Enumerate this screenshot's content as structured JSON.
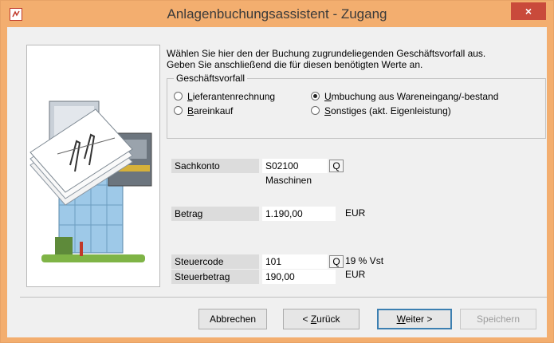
{
  "window": {
    "title": "Anlagenbuchungsassistent - Zugang",
    "close_symbol": "×"
  },
  "intro": {
    "line1": "Wählen Sie hier den der Buchung zugrundeliegenden Geschäftsvorfall aus.",
    "line2": "Geben Sie anschließend die für diesen benötigten Werte an."
  },
  "geschaeftsvorfall": {
    "legend": "Geschäftsvorfall",
    "options": [
      {
        "label": "Lieferantenrechnung",
        "mnemonic": "L",
        "rest": "ieferantenrechnung",
        "selected": false
      },
      {
        "label": "Umbuchung aus Wareneingang/-bestand",
        "mnemonic": "U",
        "rest": "mbuchung aus Wareneingang/-bestand",
        "selected": true
      },
      {
        "label": "Bareinkauf",
        "mnemonic": "B",
        "rest": "areinkauf",
        "selected": false
      },
      {
        "label": "Sonstiges (akt. Eigenleistung)",
        "mnemonic": "S",
        "rest": "onstiges (akt. Eigenleistung)",
        "selected": false
      }
    ]
  },
  "fields": {
    "sachkonto_label": "Sachkonto",
    "sachkonto_value": "S02100",
    "sachkonto_name": "Maschinen",
    "betrag_label": "Betrag",
    "betrag_value": "1.190,00",
    "betrag_currency": "EUR",
    "steuercode_label": "Steuercode",
    "steuercode_value": "101",
    "steuercode_desc": "19 % Vst",
    "steuerbetrag_label": "Steuerbetrag",
    "steuerbetrag_value": "190,00",
    "steuerbetrag_currency": "EUR",
    "lookup_symbol": "Q"
  },
  "buttons": {
    "abbrechen": "Abbrechen",
    "zurueck_prefix": "< ",
    "zurueck_mn": "Z",
    "zurueck_rest": "urück",
    "weiter_mn": "W",
    "weiter_rest": "eiter >",
    "speichern": "Speichern"
  },
  "colors": {
    "titlebar": "#f3ae6f",
    "close": "#c94a3b",
    "default_button_border": "#3c7fb1"
  }
}
